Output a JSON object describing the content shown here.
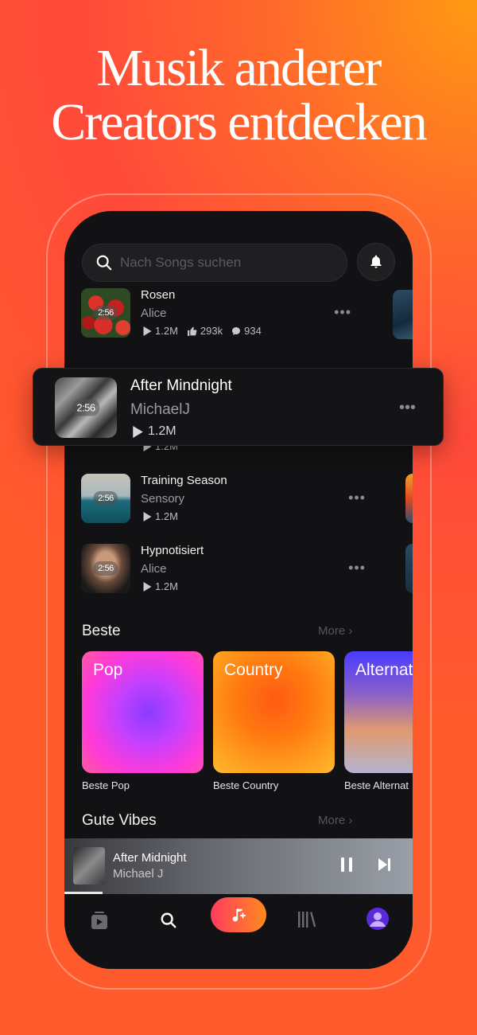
{
  "headline": {
    "line1": "Musik anderer",
    "line2": "Creators entdecken"
  },
  "search": {
    "placeholder": "Nach Songs suchen",
    "icon": "search-icon"
  },
  "notifications": {
    "icon": "bell-icon"
  },
  "songs": [
    {
      "title": "Rosen",
      "artist": "Alice",
      "duration": "2:56",
      "plays": "1.2M",
      "likes": "293k",
      "comments": "934"
    },
    {
      "title": "Training Season",
      "artist": "Sensory",
      "duration": "2:56",
      "plays": "1.2M"
    },
    {
      "title": "Hypnotisiert",
      "artist": "Alice",
      "duration": "2:56",
      "plays": "1.2M"
    }
  ],
  "hidden_row": {
    "plays": "1.2M"
  },
  "featured": {
    "title": "After Mindnight",
    "artist": "MichaelJ",
    "duration": "2:56",
    "plays": "1.2M"
  },
  "sections": {
    "beste": {
      "title": "Beste",
      "more": "More"
    },
    "gute_vibes": {
      "title": "Gute Vibes",
      "more": "More"
    }
  },
  "genres": [
    {
      "label": "Pop",
      "caption": "Beste Pop"
    },
    {
      "label": "Country",
      "caption": "Beste Country"
    },
    {
      "label": "Alternat",
      "caption": "Beste Alternat"
    }
  ],
  "player": {
    "title": "After Midnight",
    "artist": "Michael J",
    "progress": 0.11
  },
  "nav": {
    "items": [
      "feed-icon",
      "search-icon",
      "create-icon",
      "library-icon",
      "profile-icon"
    ]
  },
  "colors": {
    "accent_start": "#ff3c5e",
    "accent_end": "#ff8a1e",
    "background": "#121214"
  }
}
